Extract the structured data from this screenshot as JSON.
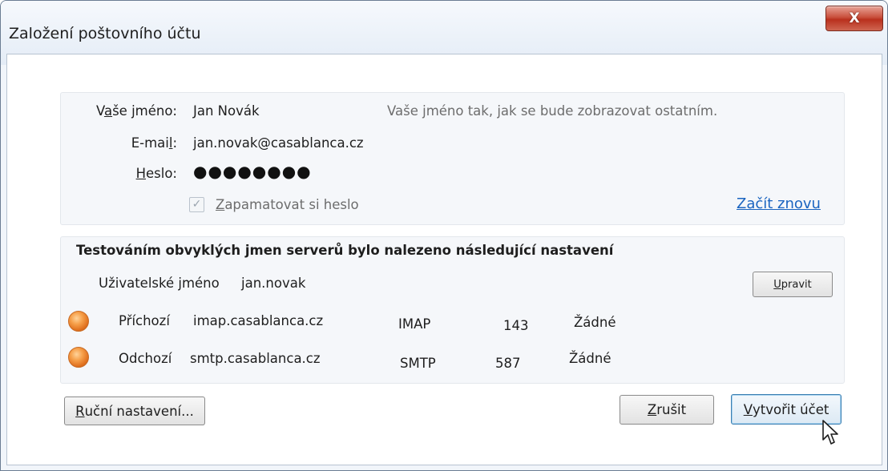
{
  "window": {
    "title": "Založení poštovního účtu",
    "close_label": "X"
  },
  "identity": {
    "name_label_pre": "V",
    "name_label_u": "a",
    "name_label_post": "še jméno:",
    "name_value": "Jan Novák",
    "name_hint": "Vaše jméno tak, jak se bude zobrazovat ostatním.",
    "email_label_pre": "E-mai",
    "email_label_u": "l",
    "email_label_post": ":",
    "email_value": "jan.novak@casablanca.cz",
    "password_label_u": "H",
    "password_label_post": "eslo:",
    "password_value": "●●●●●●●●",
    "remember_checked": true,
    "remember_label_u": "Z",
    "remember_label_post": "apamatovat si heslo",
    "restart_link": "Začít znovu"
  },
  "servers": {
    "heading": "Testováním obvyklých jmen serverů bylo nalezeno následující nastavení",
    "username_label": "Uživatelské jméno",
    "username_value": "jan.novak",
    "edit_button_u": "U",
    "edit_button_post": "pravit",
    "rows": [
      {
        "direction": "Příchozí",
        "host": "imap.casablanca.cz",
        "protocol": "IMAP",
        "port": "143",
        "security": "Žádné"
      },
      {
        "direction": "Odchozí",
        "host": "smtp.casablanca.cz",
        "protocol": "SMTP",
        "port": "587",
        "security": "Žádné"
      }
    ],
    "status_color": "#f08a2c"
  },
  "footer": {
    "manual_u": "R",
    "manual_post": "uční nastavení...",
    "cancel_u": "Z",
    "cancel_post": "rušit",
    "create_u": "V",
    "create_post": "ytvořit účet"
  },
  "colors": {
    "link": "#1a64c0",
    "close_button": "#c9503c",
    "panel_bg": "#f5f7fa"
  }
}
